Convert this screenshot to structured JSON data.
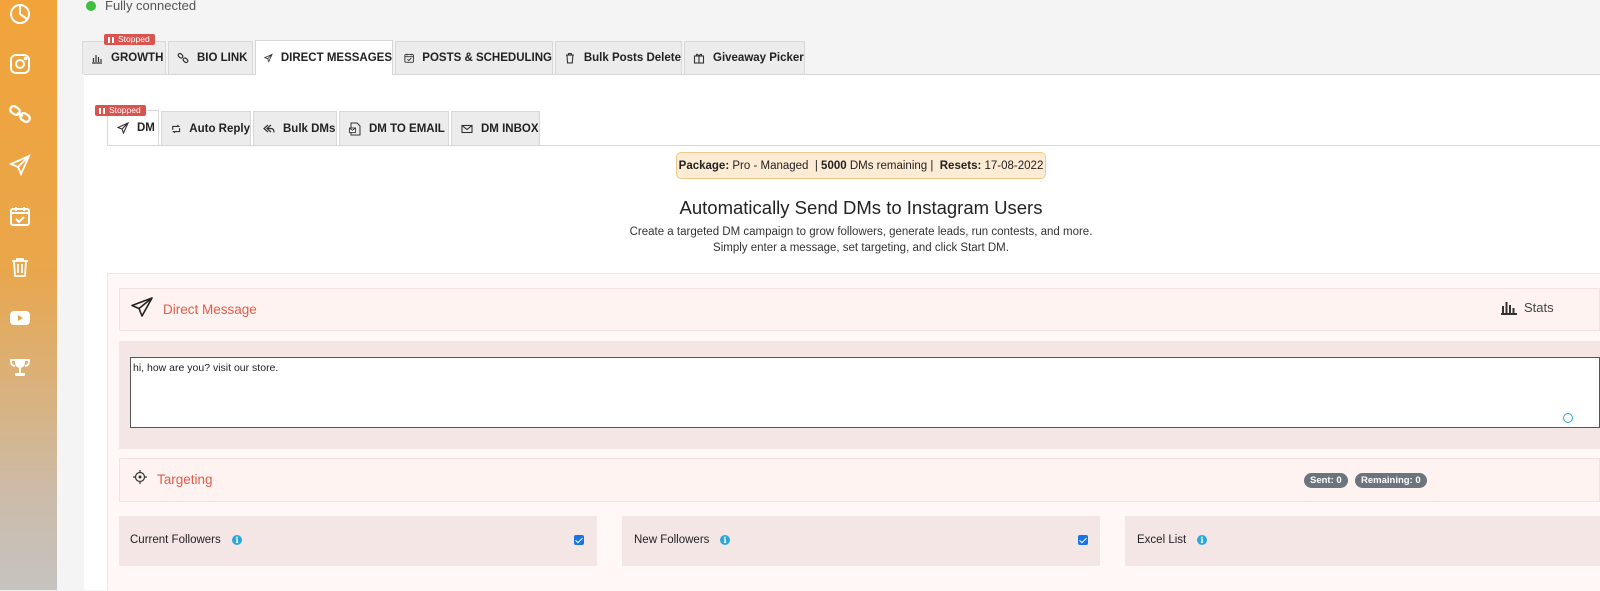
{
  "status": {
    "text": "Fully connected",
    "color": "#3fbf3f"
  },
  "sidebar": {
    "items": [
      {
        "icon": "pie-chart-icon"
      },
      {
        "icon": "instagram-icon"
      },
      {
        "icon": "link-icon"
      },
      {
        "icon": "send-icon"
      },
      {
        "icon": "calendar-check-icon"
      },
      {
        "icon": "trash-icon"
      },
      {
        "icon": "youtube-icon"
      },
      {
        "icon": "trophy-icon"
      }
    ]
  },
  "main_tabs": {
    "stopped_badge": "Stopped",
    "items": [
      {
        "label": "GROWTH",
        "icon": "bar-chart-icon"
      },
      {
        "label": "BIO LINK",
        "icon": "link-icon"
      },
      {
        "label": "DIRECT MESSAGES",
        "icon": "send-icon",
        "active": true
      },
      {
        "label": "POSTS & SCHEDULING",
        "icon": "calendar-check-icon"
      },
      {
        "label": "Bulk Posts Delete",
        "icon": "trash-icon"
      },
      {
        "label": "Giveaway Picker",
        "icon": "gift-icon"
      }
    ]
  },
  "sub_tabs": {
    "stopped_badge": "Stopped",
    "items": [
      {
        "label": "DM",
        "icon": "send-icon",
        "active": true
      },
      {
        "label": "Auto Reply",
        "icon": "retweet-icon"
      },
      {
        "label": "Bulk DMs",
        "icon": "reply-all-icon"
      },
      {
        "label": "DM TO EMAIL",
        "icon": "email-doc-icon"
      },
      {
        "label": "DM INBOX",
        "icon": "envelope-icon"
      }
    ]
  },
  "package": {
    "package_label": "Package:",
    "package_value": "Pro - Managed",
    "sep1": "|",
    "dms_count": "5000",
    "dms_text": "DMs remaining |",
    "resets_label": "Resets:",
    "resets_value": "17-08-2022"
  },
  "heading": "Automatically Send DMs to Instagram Users",
  "description": [
    "Create a targeted DM campaign to grow followers, generate leads, run contests, and more.",
    "Simply enter a message, set targeting, and click Start DM."
  ],
  "direct_message": {
    "title": "Direct Message",
    "stats_label": "Stats",
    "message_value": "hi, how are you? visit our store."
  },
  "targeting": {
    "title": "Targeting",
    "sent": "Sent: 0",
    "remaining": "Remaining: 0",
    "options": [
      {
        "label": "Current Followers",
        "checked": true
      },
      {
        "label": "New Followers",
        "checked": true
      },
      {
        "label": "Excel List",
        "checked": false
      }
    ]
  },
  "colors": {
    "accent": "#e35b47",
    "badge": "#d9534f",
    "sidebar_top": "#f2a33a"
  }
}
